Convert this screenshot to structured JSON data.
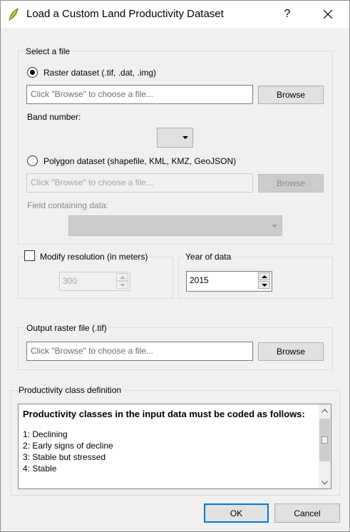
{
  "window": {
    "title": "Load a Custom Land Productivity Dataset",
    "help_label": "?"
  },
  "select_file": {
    "group_label": "Select a file",
    "raster_label": "Raster dataset (.tif, .dat, .img)",
    "raster_placeholder": "Click \"Browse\" to choose a file...",
    "browse_label": "Browse",
    "band_label": "Band number:",
    "polygon_label": "Polygon dataset (shapefile, KML, KMZ, GeoJSON)",
    "polygon_placeholder": "Click \"Browse\" to choose a file...",
    "field_label": "Field containing data:"
  },
  "resolution": {
    "label": "Modify resolution (in meters)",
    "value": "300"
  },
  "year": {
    "label": "Year of data",
    "value": "2015"
  },
  "output": {
    "group_label": "Output raster file (.tif)",
    "placeholder": "Click \"Browse\" to choose a file...",
    "browse_label": "Browse"
  },
  "definition": {
    "group_label": "Productivity class definition",
    "heading": "Productivity classes in the input data must be coded as follows:",
    "classes": [
      "1: Declining",
      "2: Early signs of decline",
      "3: Stable but stressed",
      "4: Stable"
    ]
  },
  "buttons": {
    "ok": "OK",
    "cancel": "Cancel"
  }
}
